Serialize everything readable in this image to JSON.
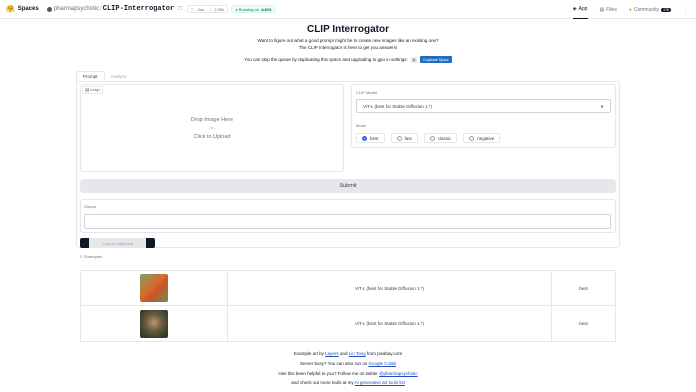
{
  "nav": {
    "spaces_label": "Spaces",
    "owner": "pharmapsychotic",
    "repo": "CLIP-Interrogator",
    "like_label": "like",
    "like_count": "2.55k",
    "status": "Running on",
    "hardware": "A10G",
    "tabs": [
      {
        "label": "App",
        "icon": "app-icon"
      },
      {
        "label": "Files",
        "icon": "files-icon"
      },
      {
        "label": "Community",
        "icon": "community-icon",
        "badge": "176"
      }
    ]
  },
  "header": {
    "title": "CLIP Interrogator",
    "line1": "Want to figure out what a good prompt might be to create new images like an existing one?",
    "line2": "The CLIP Interrogator is here to get you answers!",
    "skip_text": "You can skip the queue by duplicating this space and upgrading to gpu in settings:",
    "duplicate_label": "Duplicate Space"
  },
  "tabs": [
    "Prompt",
    "Analyze"
  ],
  "image": {
    "label": "Image",
    "drop_text": "Drop Image Here",
    "or_text": "- or -",
    "click_text": "Click to Upload"
  },
  "clip_model": {
    "label": "CLIP Model",
    "value": "ViT-L (best for Stable Diffusion 1.*)"
  },
  "mode": {
    "label": "Mode",
    "options": [
      "best",
      "fast",
      "classic",
      "negative"
    ],
    "selected": "best"
  },
  "submit_label": "Submit",
  "output": {
    "label": "Output",
    "value": ""
  },
  "copy_label": "Copy to clipboard",
  "examples": {
    "label": "Examples",
    "rows": [
      {
        "model": "ViT-L (best for Stable Diffusion 1.*)",
        "mode": "best"
      },
      {
        "model": "ViT-L (best for Stable Diffusion 1.*)",
        "mode": "best"
      }
    ]
  },
  "footer": {
    "l1a": "Example art by",
    "l1b": "Layers",
    "l1c": "and",
    "l1d": "Lin Tong",
    "l1e": "from pixabay.com",
    "l2a": "Server busy? You can also run on",
    "l2b": "Google Colab",
    "l3a": "Has this been helpful to you? Follow me on twitter",
    "l3b": "@pharmapsychotic",
    "l4a": "and check out more tools at my",
    "l4b": "Ai generative art tools list"
  }
}
